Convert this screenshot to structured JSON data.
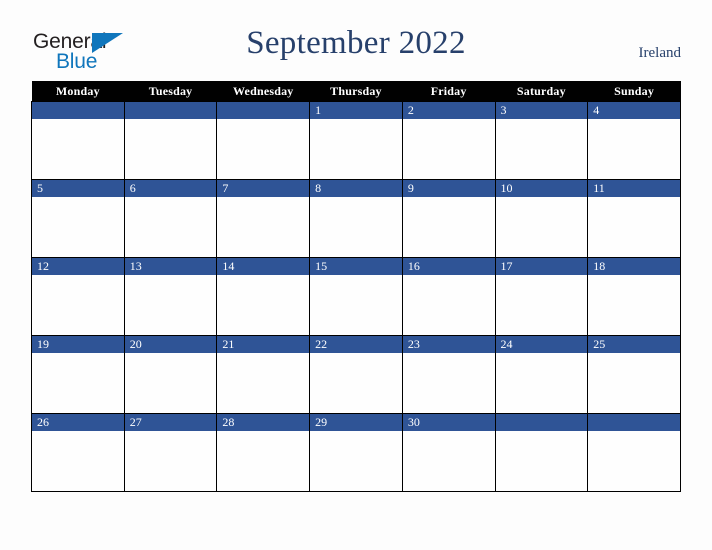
{
  "logo": {
    "word_one": "General",
    "word_two": "Blue",
    "triangle_icon": "triangle-icon",
    "color_dark": "#231f20",
    "color_blue": "#1076bc"
  },
  "header": {
    "title": "September 2022",
    "country": "Ireland",
    "title_color": "#27406b"
  },
  "calendar": {
    "month": "September",
    "year": "2022",
    "accent_color": "#2f5496",
    "header_bg": "#010101",
    "weekday_headers": [
      "Monday",
      "Tuesday",
      "Wednesday",
      "Thursday",
      "Friday",
      "Saturday",
      "Sunday"
    ],
    "weeks": [
      [
        "",
        "",
        "",
        "1",
        "2",
        "3",
        "4"
      ],
      [
        "5",
        "6",
        "7",
        "8",
        "9",
        "10",
        "11"
      ],
      [
        "12",
        "13",
        "14",
        "15",
        "16",
        "17",
        "18"
      ],
      [
        "19",
        "20",
        "21",
        "22",
        "23",
        "24",
        "25"
      ],
      [
        "26",
        "27",
        "28",
        "29",
        "30",
        "",
        ""
      ]
    ]
  }
}
